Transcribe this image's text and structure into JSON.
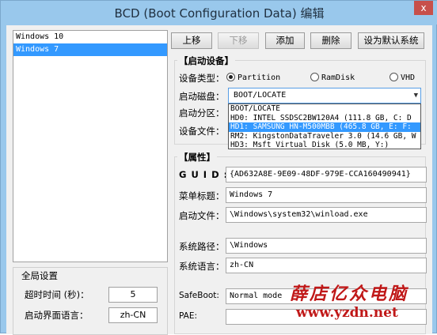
{
  "window": {
    "title": "BCD (Boot Configuration Data) 编辑",
    "close": "x"
  },
  "os_list": [
    "Windows 10",
    "Windows 7"
  ],
  "os_selected": 1,
  "toolbar": {
    "up": "上移",
    "down": "下移",
    "add": "添加",
    "delete": "删除",
    "set_default": "设为默认系统"
  },
  "boot_device": {
    "title": "【启动设备】",
    "device_type_label": "设备类型：",
    "types": [
      "Partition",
      "RamDisk",
      "VHD"
    ],
    "selected_type": "Partition",
    "disk_label": "启动磁盘：",
    "disk_value": "BOOT/LOCATE",
    "partition_label": "启动分区：",
    "file_label": "设备文件：",
    "dropdown_options": [
      "BOOT/LOCATE",
      "HD0: INTEL SSDSC2BW120A4 (111.8 GB, C: D",
      "HD1: SAMSUNG HN-M500MBB (465.8 GB, E: F:",
      "RM2: KingstonDataTraveler 3.0 (14.6 GB, W",
      "HD3: Msft Virtual Disk (5.0 MB, Y:)"
    ],
    "dropdown_highlight": 2
  },
  "properties": {
    "title": "【属性】",
    "guid_label": "G U I D :",
    "guid": "{AD632A8E-9E09-48DF-979E-CCA160490941}",
    "menu_title_label": "菜单标题：",
    "menu_title": "Windows 7",
    "boot_file_label": "启动文件：",
    "boot_file": "\\Windows\\system32\\winload.exe",
    "sys_path_label": "系统路径：",
    "sys_path": "\\Windows",
    "sys_lang_label": "系统语言：",
    "sys_lang": "zh-CN",
    "safeboot_label": "SafeBoot:",
    "safeboot_value": "Normal mode",
    "pae_label": "PAE:"
  },
  "global": {
    "title": "全局设置",
    "timeout_label": "超时时间 (秒)：",
    "timeout": "5",
    "lang_label": "启动界面语言：",
    "lang": "zh-CN"
  },
  "watermark": {
    "line1": "薛店亿众电脑",
    "line2": "www.yzdn.net"
  }
}
